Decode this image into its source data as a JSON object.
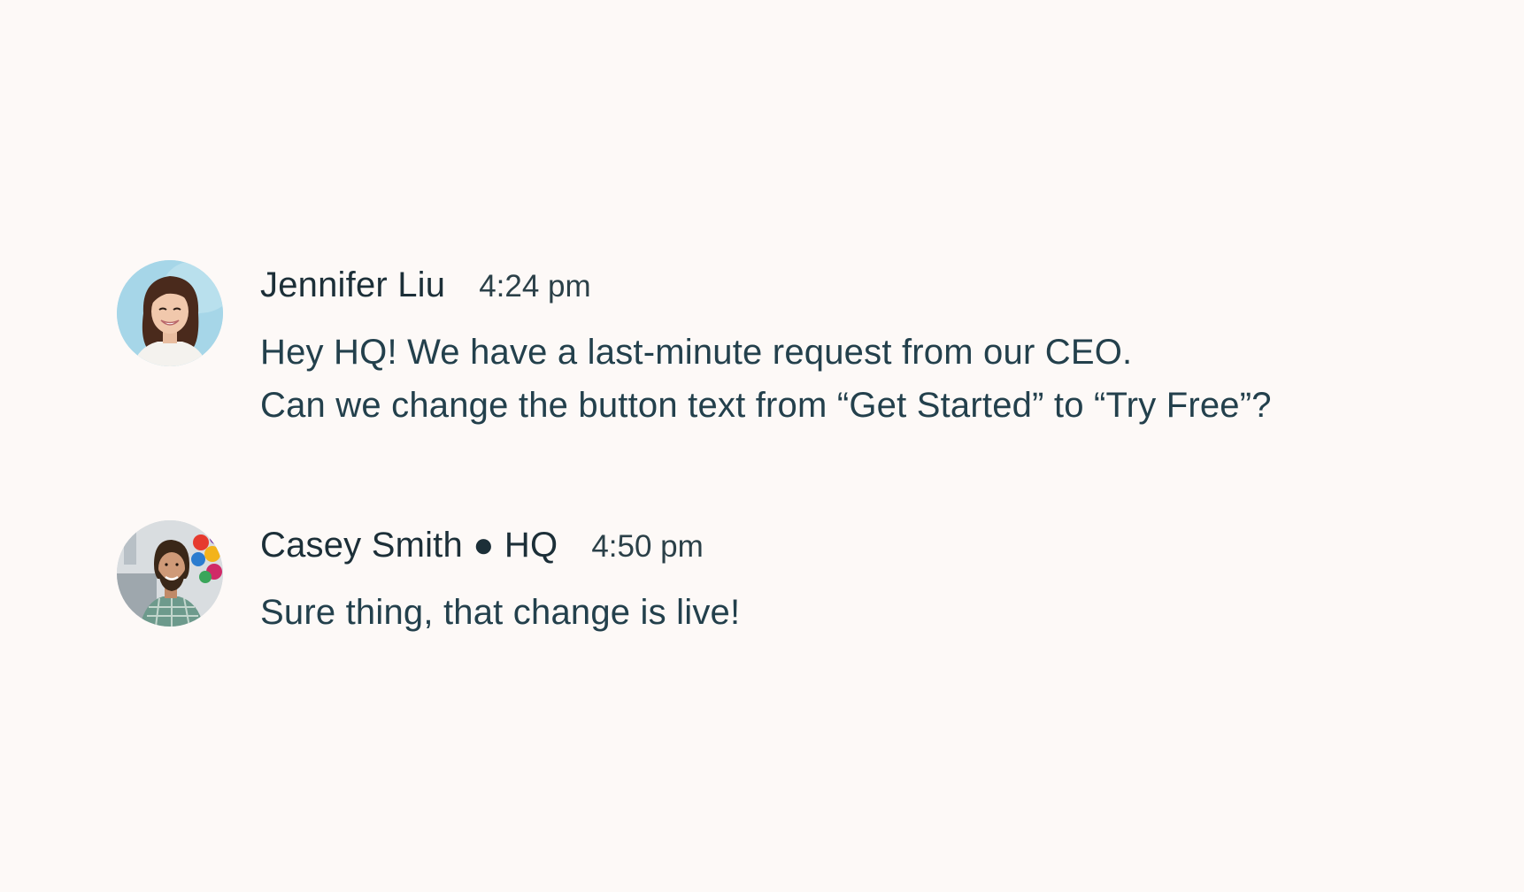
{
  "messages": [
    {
      "author": "Jennifer Liu",
      "time": "4:24 pm",
      "lines": [
        "Hey HQ! We have a last-minute request from our CEO.",
        "Can we change the button text from “Get Started” to “Try Free”?"
      ],
      "avatar_icon": "avatar-photo-jennifer"
    },
    {
      "author": "Casey Smith ● HQ",
      "time": "4:50 pm",
      "lines": [
        "Sure thing, that change is live!"
      ],
      "avatar_icon": "avatar-photo-casey"
    }
  ],
  "colors": {
    "background": "#fdf9f7",
    "text": "#23404c",
    "name": "#1c2f38"
  }
}
